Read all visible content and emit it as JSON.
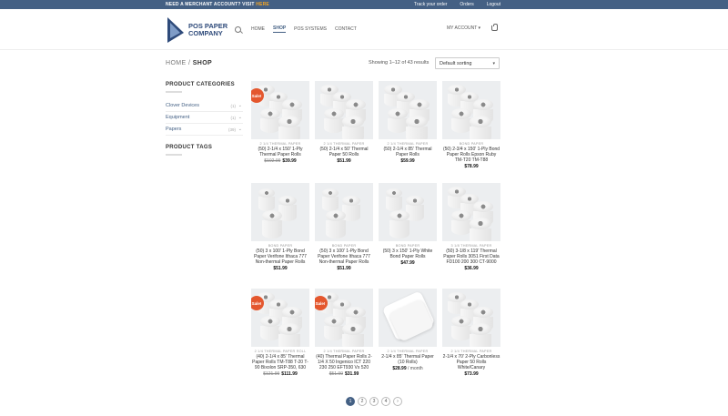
{
  "topbar": {
    "promo_text": "NEED A MERCHANT ACCOUNT? VISIT",
    "promo_link": "HERE",
    "links": [
      "Track your order",
      "Orders",
      "Logout"
    ]
  },
  "logo": {
    "line1": "POS PAPER",
    "line2": "COMPANY"
  },
  "nav": {
    "items": [
      "HOME",
      "SHOP",
      "POS SYSTEMS",
      "CONTACT"
    ],
    "account": "MY ACCOUNT"
  },
  "breadcrumb": {
    "home": "HOME",
    "sep": "/",
    "current": "SHOP"
  },
  "results_text": "Showing 1–12 of 43 results",
  "sort": {
    "selected": "Default sorting"
  },
  "sidebar": {
    "categories_title": "PRODUCT CATEGORIES",
    "categories": [
      {
        "label": "Clover Devices",
        "count": "(1)"
      },
      {
        "label": "Equipment",
        "count": "(1)"
      },
      {
        "label": "Papers",
        "count": "(39)"
      }
    ],
    "tags_title": "PRODUCT TAGS"
  },
  "products": [
    {
      "category": "2 1/4 THERMAL PAPER",
      "title": "(50) 2-1/4 x 150' 1-Ply Thermal Paper Rolls",
      "old_price": "$102.99",
      "price": "$39.99",
      "sale": true,
      "kind": "rolls"
    },
    {
      "category": "2 1/4 THERMAL PAPER",
      "title": "(50) 2-1/4 x 50' Thermal Paper 50 Rolls",
      "old_price": "",
      "price": "$51.99",
      "sale": false,
      "kind": "rolls"
    },
    {
      "category": "2 1/4 THERMAL PAPER",
      "title": "(50) 2-1/4 x 85' Thermal Paper Rolls",
      "old_price": "",
      "price": "$59.99",
      "sale": false,
      "kind": "rolls"
    },
    {
      "category": "BOND PAPER",
      "title": "(50) 2-3/4 x 150' 1-Ply Bond Paper Rolls Epson Ruby TM-T20 TM-T88",
      "old_price": "",
      "price": "$78.99",
      "sale": false,
      "kind": "rolls"
    },
    {
      "category": "BOND PAPER",
      "title": "(50) 3 x 100' 1-Ply Bond Paper Verifone Ithaca 777 Non-thermal Paper Rolls",
      "old_price": "",
      "price": "$51.99",
      "sale": false,
      "kind": "bond"
    },
    {
      "category": "BOND PAPER",
      "title": "(50) 3 x 100' 1-Ply Bond Paper Verifone Ithaca 777 Non-thermal Paper Rolls",
      "old_price": "",
      "price": "$51.99",
      "sale": false,
      "kind": "bond"
    },
    {
      "category": "BOND PAPER",
      "title": "(50) 3 x 150' 1-Ply White Bond Paper Rolls",
      "old_price": "",
      "price": "$47.99",
      "sale": false,
      "kind": "bond"
    },
    {
      "category": "3 1/8 THERMAL PAPER",
      "title": "(50) 3-1/8 x 119' Thermal Paper Rolls 3051 First Data FD100 200 300 CT-9000",
      "old_price": "",
      "price": "$36.99",
      "sale": false,
      "kind": "rolls"
    },
    {
      "category": "2 1/4 THERMAL PAPER ROLL",
      "title": "(40) 2-1/4 x 85' Thermal Paper Rolls TM-T88 T-20 T-90 Bixolon SRP-350, 630",
      "old_price": "$121.99",
      "price": "$111.99",
      "sale": true,
      "kind": "rolls"
    },
    {
      "category": "2 1/4 THERMAL PAPER",
      "title": "(40) Thermal Paper Rolls 2-1/4 X 50 Ingenico ICT 220 230 250 EFT930 Vx 520",
      "old_price": "$51.99",
      "price": "$31.99",
      "sale": true,
      "kind": "rolls"
    },
    {
      "category": "2 1/4 THERMAL PAPER",
      "title": "2-1/4 x 85' Thermal Paper (10 Rolls)",
      "old_price": "",
      "price": "$28.99",
      "unit": "/ month",
      "sale": false,
      "kind": "sheet"
    },
    {
      "category": "2 1/4 THERMAL PAPER",
      "title": "2-1/4 x 70' 2-Ply Carbonless Paper 50 Rolls White/Canary",
      "old_price": "",
      "price": "$73.99",
      "sale": false,
      "kind": "rolls"
    }
  ],
  "pagination": {
    "pages": [
      "1",
      "2",
      "3",
      "4"
    ],
    "current": "1",
    "next": "›"
  }
}
